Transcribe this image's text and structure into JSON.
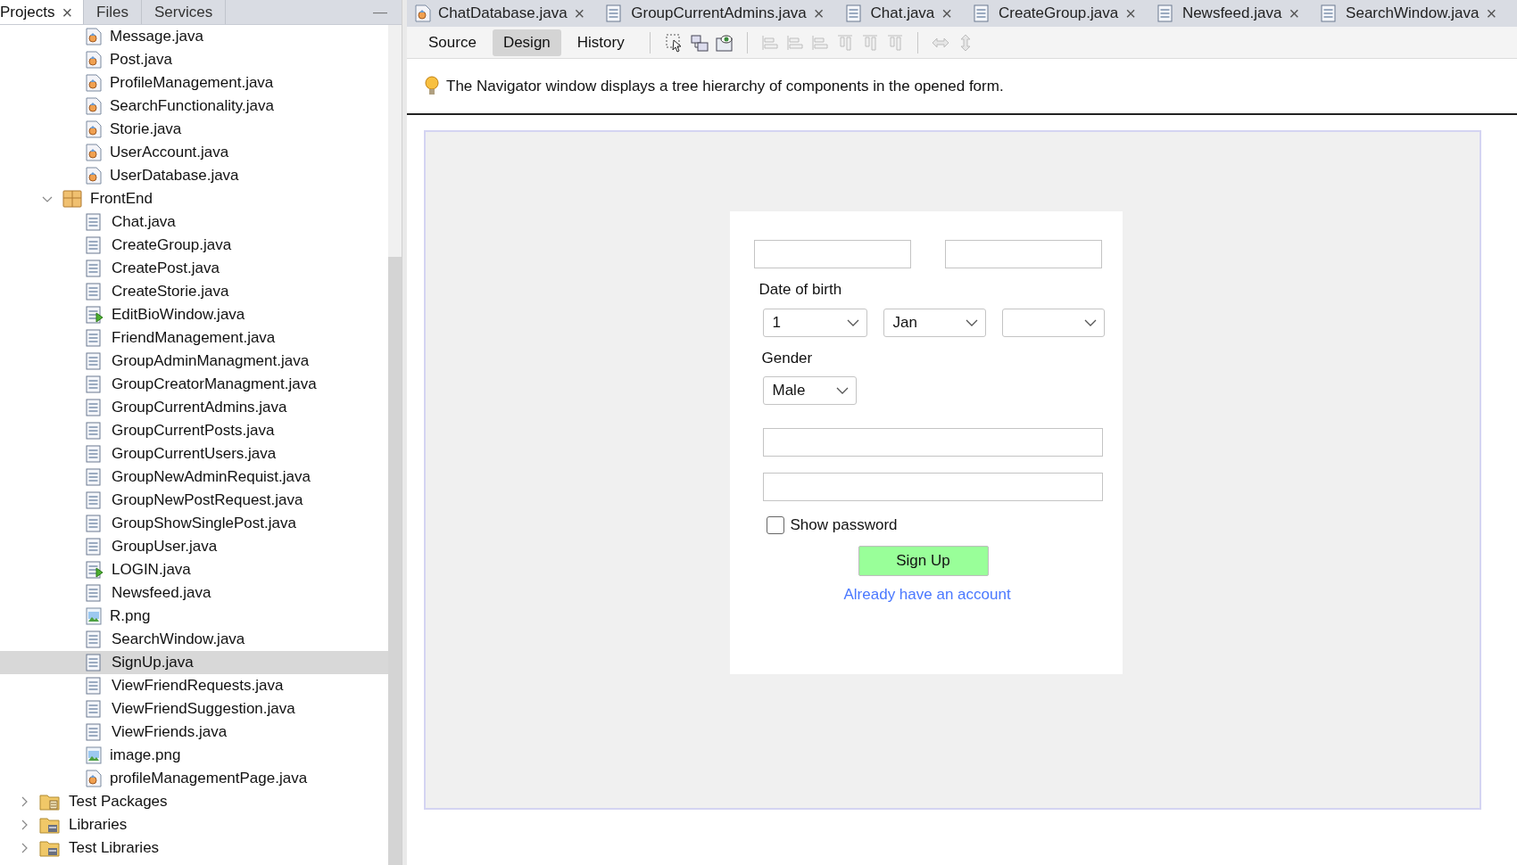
{
  "left_panel": {
    "tabs": [
      {
        "label": "Projects",
        "selected": true,
        "close": "×"
      },
      {
        "label": "Files",
        "selected": false
      },
      {
        "label": "Services",
        "selected": false
      }
    ],
    "minimize": "—",
    "tree": [
      {
        "children": [
          {
            "children": [
              {
                "label": "Message.java",
                "kind": "class",
                "selected": false
              },
              {
                "label": "Post.java",
                "kind": "class",
                "selected": false
              },
              {
                "label": "ProfileManagement.java",
                "kind": "class",
                "selected": false
              },
              {
                "label": "SearchFunctionality.java",
                "kind": "class",
                "selected": false
              },
              {
                "label": "Storie.java",
                "kind": "class",
                "selected": false
              },
              {
                "label": "UserAccount.java",
                "kind": "class",
                "selected": false
              },
              {
                "label": "UserDatabase.java",
                "kind": "class",
                "selected": false
              }
            ]
          },
          {
            "label": "FrontEnd",
            "kind": "package",
            "selected": false,
            "expanded": true,
            "children": [
              {
                "label": "Chat.java",
                "kind": "form",
                "selected": false
              },
              {
                "label": "CreateGroup.java",
                "kind": "form",
                "selected": false
              },
              {
                "label": "CreatePost.java",
                "kind": "form",
                "selected": false
              },
              {
                "label": "CreateStorie.java",
                "kind": "form",
                "selected": false
              },
              {
                "label": "EditBioWindow.java",
                "kind": "main-form",
                "selected": false
              },
              {
                "label": "FriendManagement.java",
                "kind": "form",
                "selected": false
              },
              {
                "label": "GroupAdminManagment.java",
                "kind": "form",
                "selected": false
              },
              {
                "label": "GroupCreatorManagment.java",
                "kind": "form",
                "selected": false
              },
              {
                "label": "GroupCurrentAdmins.java",
                "kind": "form",
                "selected": false
              },
              {
                "label": "GroupCurrentPosts.java",
                "kind": "form",
                "selected": false
              },
              {
                "label": "GroupCurrentUsers.java",
                "kind": "form",
                "selected": false
              },
              {
                "label": "GroupNewAdminRequist.java",
                "kind": "form",
                "selected": false
              },
              {
                "label": "GroupNewPostRequest.java",
                "kind": "form",
                "selected": false
              },
              {
                "label": "GroupShowSinglePost.java",
                "kind": "form",
                "selected": false
              },
              {
                "label": "GroupUser.java",
                "kind": "form",
                "selected": false
              },
              {
                "label": "LOGIN.java",
                "kind": "main-form",
                "selected": false
              },
              {
                "label": "Newsfeed.java",
                "kind": "form",
                "selected": false
              },
              {
                "label": "R.png",
                "kind": "image",
                "selected": false
              },
              {
                "label": "SearchWindow.java",
                "kind": "form",
                "selected": false
              },
              {
                "label": "SignUp.java",
                "kind": "form",
                "selected": true
              },
              {
                "label": "ViewFriendRequests.java",
                "kind": "form",
                "selected": false
              },
              {
                "label": "ViewFriendSuggestion.java",
                "kind": "form",
                "selected": false
              },
              {
                "label": "ViewFriends.java",
                "kind": "form",
                "selected": false
              },
              {
                "label": "image.png",
                "kind": "image",
                "selected": false
              },
              {
                "label": "profileManagementPage.java",
                "kind": "class",
                "selected": false
              }
            ]
          }
        ]
      },
      {
        "label": "Test Packages",
        "kind": "test-folder",
        "selected": false,
        "expanded": false
      },
      {
        "label": "Libraries",
        "kind": "library",
        "selected": false,
        "expanded": false
      },
      {
        "label": "Test Libraries",
        "kind": "library",
        "selected": false,
        "expanded": false
      }
    ]
  },
  "editor_tabs": [
    {
      "label": "ChatDatabase.java",
      "kind": "class",
      "selected": false,
      "close": "×"
    },
    {
      "label": "GroupCurrentAdmins.java",
      "kind": "form",
      "selected": false,
      "close": "×"
    },
    {
      "label": "Chat.java",
      "kind": "form",
      "selected": false,
      "close": "×"
    },
    {
      "label": "CreateGroup.java",
      "kind": "form",
      "selected": false,
      "close": "×"
    },
    {
      "label": "Newsfeed.java",
      "kind": "form",
      "selected": false,
      "close": "×"
    },
    {
      "label": "SearchWindow.java",
      "kind": "form",
      "selected": false,
      "close": "×"
    }
  ],
  "view_modes": [
    {
      "label": "Source",
      "selected": false
    },
    {
      "label": "Design",
      "selected": true
    },
    {
      "label": "History",
      "selected": false
    }
  ],
  "hint": "The Navigator window displays a tree hierarchy of components in the opened form.",
  "form": {
    "date_label": "Date of birth",
    "date_selects": [
      {
        "kind": "dropdown",
        "value": "1"
      },
      {
        "kind": "dropdown",
        "value": "Jan"
      },
      {
        "kind": "dropdown"
      }
    ],
    "gender_label": "Gender",
    "gender_select": {
      "value": "Male"
    },
    "show_password": {
      "label": "Show password",
      "checked": false
    },
    "submit": "Sign Up",
    "login_link": "Already have an account"
  }
}
